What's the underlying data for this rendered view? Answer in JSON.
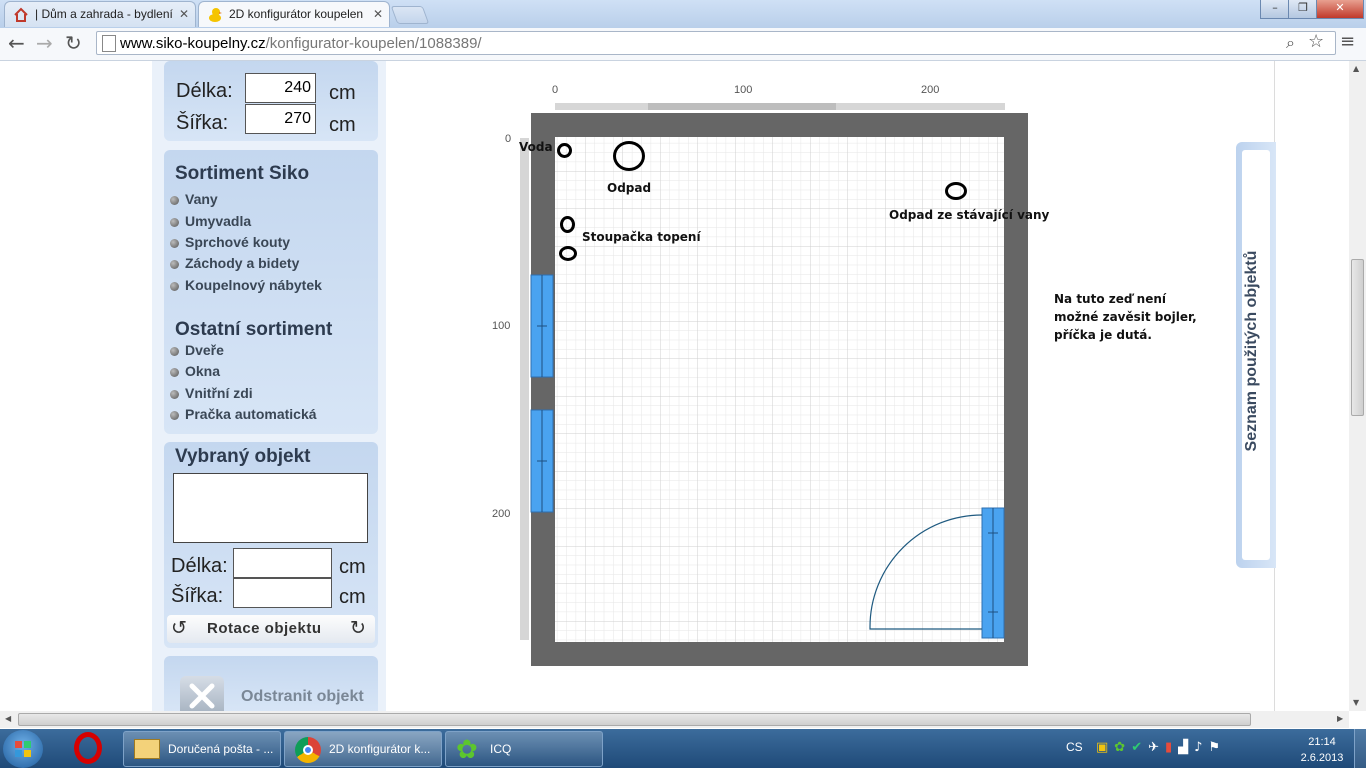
{
  "browser": {
    "tabs": [
      {
        "label": "| Dům a zahrada - bydlení",
        "active": false
      },
      {
        "label": "2D konfigurátor koupelen",
        "active": true
      }
    ],
    "url_domain": "www.siko-koupelny.cz",
    "url_path": "/konfigurator-koupelen/1088389/",
    "window_buttons": [
      "–",
      "❐",
      "✕"
    ]
  },
  "dimensions": {
    "length_label": "Délka:",
    "length_value": "240",
    "width_label": "Šířka:",
    "width_value": "270",
    "unit": "cm"
  },
  "sortiment_siko": {
    "title": "Sortiment Siko",
    "items": [
      "Vany",
      "Umyvadla",
      "Sprchové kouty",
      "Záchody a bidety",
      "Koupelnový nábytek"
    ]
  },
  "ostatni_sortiment": {
    "title": "Ostatní sortiment",
    "items": [
      "Dveře",
      "Okna",
      "Vnitřní zdi",
      "Pračka automatická"
    ]
  },
  "selected_object": {
    "title": "Vybraný objekt",
    "length_label": "Délka:",
    "width_label": "Šířka:",
    "length_value": "",
    "width_value": "",
    "unit": "cm",
    "rotate_label": "Rotace objektu",
    "remove_label": "Odstranit objekt"
  },
  "canvas": {
    "ruler_x": [
      "0",
      "100",
      "200"
    ],
    "ruler_y": [
      "0",
      "100",
      "200"
    ],
    "labels": {
      "voda": "Voda",
      "odpad": "Odpad",
      "odpad_vany": "Odpad ze stávající vany",
      "stoupacka": "Stoupačka topení"
    },
    "note": [
      "Na tuto zeď není",
      "možné zavěsit bojler,",
      "příčka je dutá."
    ]
  },
  "used_objects_tab": "Seznam použitých objektů",
  "taskbar": {
    "items": [
      "Doručená pošta - ...",
      "2D konfigurátor k...",
      "ICQ"
    ],
    "language": "CS",
    "time": "21:14",
    "date": "2.6.2013"
  },
  "colors": {
    "wall": "#666666",
    "window_blue": "#4aa3f0",
    "panel_bg": "#c9dbf1",
    "taskbar": "#2b5a8a"
  }
}
